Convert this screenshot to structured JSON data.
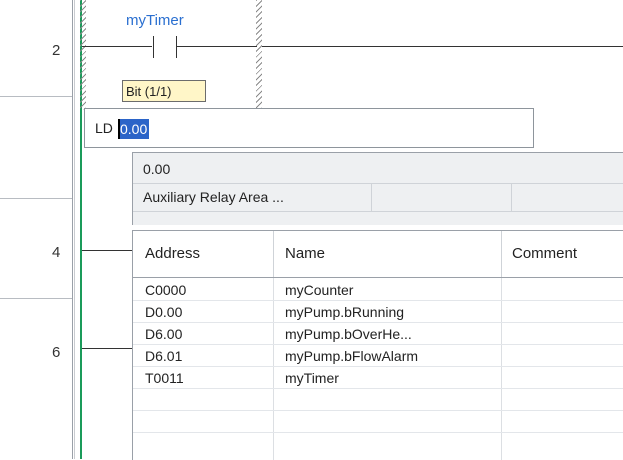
{
  "rung_numbers": [
    "2",
    "4",
    "6"
  ],
  "rung2": {
    "operand_label": "myTimer",
    "tooltip": "Bit (1/1)"
  },
  "ld_editor": {
    "instruction": "LD",
    "value": "0.00"
  },
  "info_panel": {
    "address": "0.00",
    "area": "Auxiliary Relay Area ..."
  },
  "symbol_table": {
    "columns": [
      "Address",
      "Name",
      "Comment"
    ],
    "rows": [
      {
        "address": "C0000",
        "name": "myCounter",
        "comment": ""
      },
      {
        "address": "D0.00",
        "name": "myPump.bRunning",
        "comment": ""
      },
      {
        "address": "D6.00",
        "name": "myPump.bOverHe...",
        "comment": ""
      },
      {
        "address": "D6.01",
        "name": "myPump.bFlowAlarm",
        "comment": ""
      },
      {
        "address": "T0011",
        "name": "myTimer",
        "comment": ""
      }
    ]
  },
  "colors": {
    "power_rail": "#1a9b5a",
    "selection": "#2b64c8",
    "tooltip_bg": "#fff6c8",
    "operand_text": "#2a6fd0"
  }
}
